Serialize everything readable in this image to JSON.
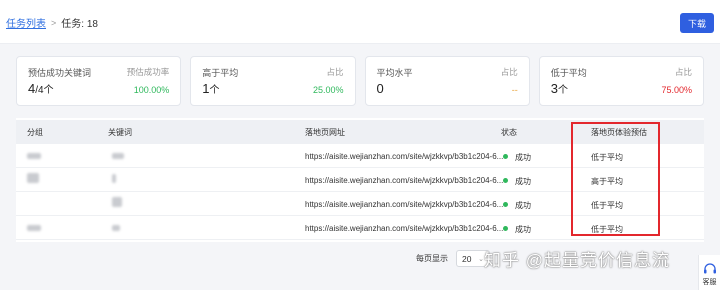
{
  "breadcrumb": {
    "parent": "任务列表",
    "separator": ">",
    "current": "任务: 18"
  },
  "toolbar": {
    "download_label": "下载"
  },
  "cards": [
    {
      "title": "预估成功关键词",
      "sub": "预估成功率",
      "value_main": "4",
      "value_suffix": "/4个",
      "pct": "100.00%",
      "pct_color": "#2fb85c"
    },
    {
      "title": "高于平均",
      "sub": "占比",
      "value_main": "1",
      "value_suffix": "个",
      "pct": "25.00%",
      "pct_color": "#2fb85c"
    },
    {
      "title": "平均水平",
      "sub": "占比",
      "value_main": "0",
      "value_suffix": "",
      "pct": "--",
      "pct_color": "#e8a33c"
    },
    {
      "title": "低于平均",
      "sub": "占比",
      "value_main": "3",
      "value_suffix": "个",
      "pct": "75.00%",
      "pct_color": "#e3272d"
    }
  ],
  "table": {
    "headers": [
      "分组",
      "关键词",
      "落地页网址",
      "状态",
      "落地页体验预估"
    ],
    "rows": [
      {
        "url": "https://aisite.wejianzhan.com/site/wjzkkvp/b3b1c204-6...",
        "status": "成功",
        "estimate": "低于平均"
      },
      {
        "url": "https://aisite.wejianzhan.com/site/wjzkkvp/b3b1c204-6...",
        "status": "成功",
        "estimate": "高于平均"
      },
      {
        "url": "https://aisite.wejianzhan.com/site/wjzkkvp/b3b1c204-6...",
        "status": "成功",
        "estimate": "低于平均"
      },
      {
        "url": "https://aisite.wejianzhan.com/site/wjzkkvp/b3b1c204-6...",
        "status": "成功",
        "estimate": "低于平均"
      }
    ]
  },
  "pagination": {
    "label": "每页显示",
    "page_size": "20"
  },
  "watermark": "知乎 @起量竞价信息流",
  "service": {
    "label": "客服",
    "icon": "headset-icon"
  },
  "colors": {
    "accent": "#2f5fe0",
    "success": "#2fb85c",
    "danger": "#e3272d",
    "highlight_box": "#e3272d"
  }
}
